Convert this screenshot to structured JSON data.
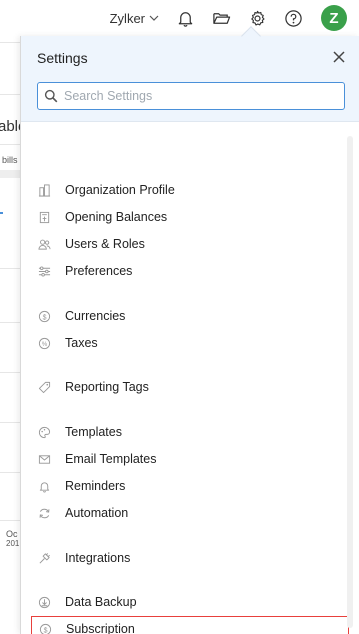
{
  "topbar": {
    "org_name": "Zylker",
    "avatar_letter": "Z",
    "avatar_color": "#3aa04a"
  },
  "background": {
    "fragment_title": "able",
    "fragment_bills": "bills",
    "fragment_date_1": "Oc",
    "fragment_date_2": "201"
  },
  "settings": {
    "title": "Settings",
    "search_placeholder": "Search Settings",
    "items": [
      {
        "label": "Organization Profile",
        "icon": "building-icon"
      },
      {
        "label": "Opening Balances",
        "icon": "document-balance-icon"
      },
      {
        "label": "Users & Roles",
        "icon": "users-icon"
      },
      {
        "label": "Preferences",
        "icon": "sliders-icon"
      },
      {
        "label": "Currencies",
        "icon": "currency-icon"
      },
      {
        "label": "Taxes",
        "icon": "percent-icon"
      },
      {
        "label": "Reporting Tags",
        "icon": "tag-icon"
      },
      {
        "label": "Templates",
        "icon": "palette-icon"
      },
      {
        "label": "Email Templates",
        "icon": "envelope-icon"
      },
      {
        "label": "Reminders",
        "icon": "bell-icon"
      },
      {
        "label": "Automation",
        "icon": "refresh-icon"
      },
      {
        "label": "Integrations",
        "icon": "plug-icon"
      },
      {
        "label": "Data Backup",
        "icon": "backup-icon"
      },
      {
        "label": "Subscription",
        "icon": "subscription-icon"
      }
    ],
    "highlight_color": "#e8403c"
  }
}
